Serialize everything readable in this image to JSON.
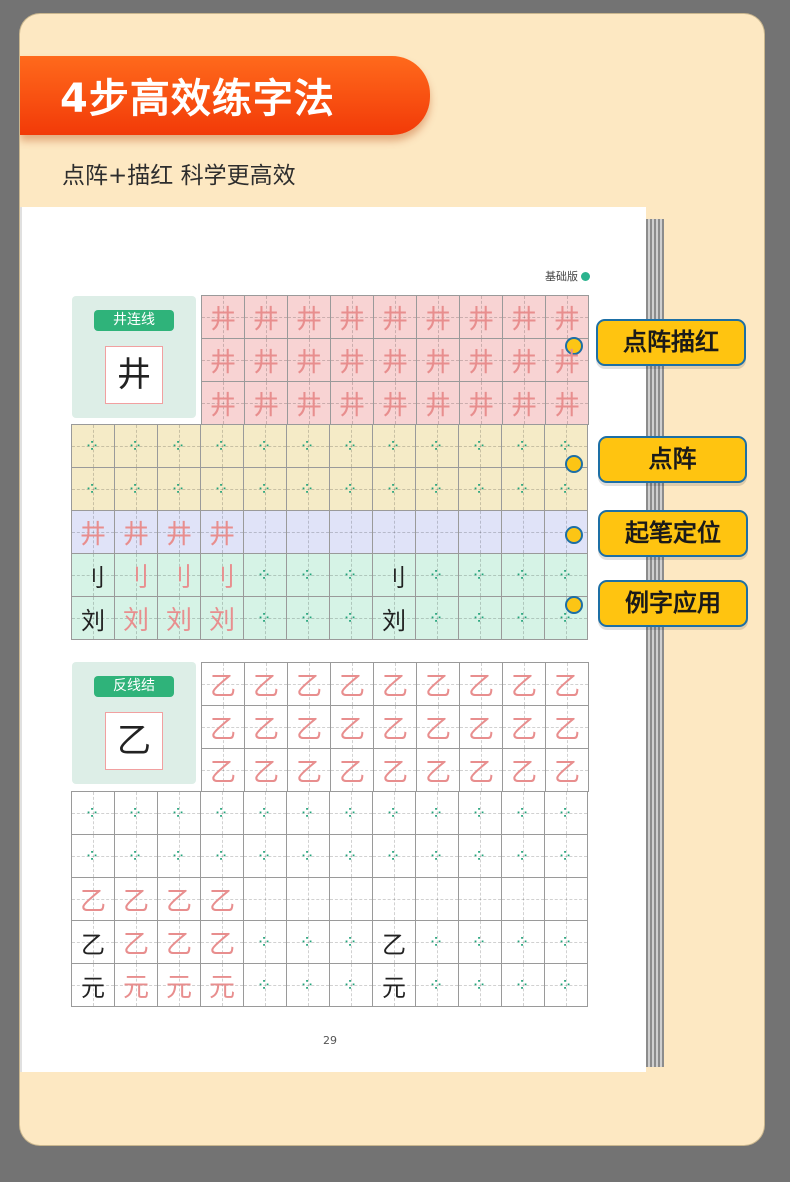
{
  "header": {
    "title": "4步高效练字法",
    "subtitle": "点阵+描红  科学更高效"
  },
  "book": {
    "edition_label": "基础版",
    "page_number": "29",
    "lessons": [
      {
        "tag": "井连线",
        "model_char": "井",
        "rows": [
          {
            "kind": "trace",
            "bg": "#f8d3d3",
            "cells": [
              "井",
              "井",
              "井",
              "井",
              "井",
              "井",
              "井",
              "井",
              "井"
            ]
          },
          {
            "kind": "trace",
            "bg": "#f8d3d3",
            "cells": [
              "井",
              "井",
              "井",
              "井",
              "井",
              "井",
              "井",
              "井",
              "井"
            ]
          },
          {
            "kind": "trace",
            "bg": "#f8d3d3",
            "cells": [
              "井",
              "井",
              "井",
              "井",
              "井",
              "井",
              "井",
              "井",
              "井"
            ]
          },
          {
            "kind": "dots",
            "bg": "#f5ebc7",
            "cells": [
              "⁘",
              "⁘",
              "⁘",
              "⁘",
              "⁘",
              "⁘",
              "⁘",
              "⁘",
              "⁘",
              "⁘",
              "⁘",
              "⁘"
            ]
          },
          {
            "kind": "dots",
            "bg": "#f5ebc7",
            "cells": [
              "⁘",
              "⁘",
              "⁘",
              "⁘",
              "⁘",
              "⁘",
              "⁘",
              "⁘",
              "⁘",
              "⁘",
              "⁘",
              "⁘"
            ]
          },
          {
            "kind": "trace",
            "bg": "#e0e3f8",
            "cells": [
              "井",
              "井",
              "井",
              "井",
              "",
              "",
              "",
              "",
              "",
              "",
              "",
              ""
            ]
          },
          {
            "kind": "mixed",
            "bg": "#d6f3e6",
            "cells": [
              "刂",
              "刂",
              "刂",
              "刂",
              "⁘",
              "⁘",
              "⁘",
              "刂",
              "⁘",
              "⁘",
              "⁘",
              "⁘"
            ]
          },
          {
            "kind": "mixed",
            "bg": "#d6f3e6",
            "cells": [
              "刘",
              "刘",
              "刘",
              "刘",
              "⁘",
              "⁘",
              "⁘",
              "刘",
              "⁘",
              "⁘",
              "⁘",
              "⁘"
            ]
          }
        ]
      },
      {
        "tag": "反线结",
        "model_char": "乙",
        "rows": [
          {
            "kind": "trace",
            "bg": "#ffffff",
            "cells": [
              "乙",
              "乙",
              "乙",
              "乙",
              "乙",
              "乙",
              "乙",
              "乙",
              "乙"
            ]
          },
          {
            "kind": "trace",
            "bg": "#ffffff",
            "cells": [
              "乙",
              "乙",
              "乙",
              "乙",
              "乙",
              "乙",
              "乙",
              "乙",
              "乙"
            ]
          },
          {
            "kind": "trace",
            "bg": "#ffffff",
            "cells": [
              "乙",
              "乙",
              "乙",
              "乙",
              "乙",
              "乙",
              "乙",
              "乙",
              "乙"
            ]
          },
          {
            "kind": "dots",
            "bg": "#ffffff",
            "cells": [
              "⁘",
              "⁘",
              "⁘",
              "⁘",
              "⁘",
              "⁘",
              "⁘",
              "⁘",
              "⁘",
              "⁘",
              "⁘",
              "⁘"
            ]
          },
          {
            "kind": "dots",
            "bg": "#ffffff",
            "cells": [
              "⁘",
              "⁘",
              "⁘",
              "⁘",
              "⁘",
              "⁘",
              "⁘",
              "⁘",
              "⁘",
              "⁘",
              "⁘",
              "⁘"
            ]
          },
          {
            "kind": "trace",
            "bg": "#ffffff",
            "cells": [
              "乙",
              "乙",
              "乙",
              "乙",
              "",
              "",
              "",
              "",
              "",
              "",
              "",
              ""
            ]
          },
          {
            "kind": "mixed",
            "bg": "#ffffff",
            "cells": [
              "乙",
              "乙",
              "乙",
              "乙",
              "⁘",
              "⁘",
              "⁘",
              "乙",
              "⁘",
              "⁘",
              "⁘",
              "⁘"
            ]
          },
          {
            "kind": "mixed",
            "bg": "#ffffff",
            "cells": [
              "元",
              "元",
              "元",
              "元",
              "⁘",
              "⁘",
              "⁘",
              "元",
              "⁘",
              "⁘",
              "⁘",
              "⁘"
            ]
          }
        ]
      }
    ]
  },
  "callouts": [
    "点阵描红",
    "点阵",
    "起笔定位",
    "例字应用"
  ],
  "colors": {
    "banner": "#f23a08",
    "card": "#fde8c2",
    "callout": "#ffc410",
    "callout_border": "#1d6fa5",
    "trace": "#e88e8e",
    "dots": "#22a37a"
  }
}
